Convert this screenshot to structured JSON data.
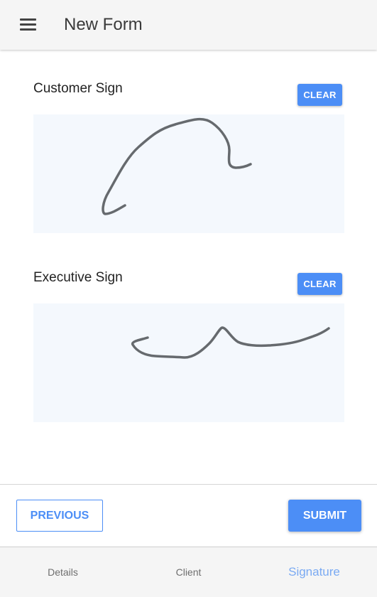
{
  "header": {
    "title": "New Form",
    "menu_icon": "hamburger-menu-icon"
  },
  "signatures": [
    {
      "label": "Customer Sign",
      "clear_label": "CLEAR"
    },
    {
      "label": "Executive Sign",
      "clear_label": "CLEAR"
    }
  ],
  "footer": {
    "previous_label": "PREVIOUS",
    "submit_label": "SUBMIT"
  },
  "bottom_nav": {
    "tabs": [
      {
        "label": "Details",
        "active": false
      },
      {
        "label": "Client",
        "active": false
      },
      {
        "label": "Signature",
        "active": true
      }
    ]
  },
  "colors": {
    "accent": "#4c8ef6",
    "active_tab": "#7aaaf3",
    "pad_background": "#f4f8fd",
    "ink": "#666a6e"
  }
}
